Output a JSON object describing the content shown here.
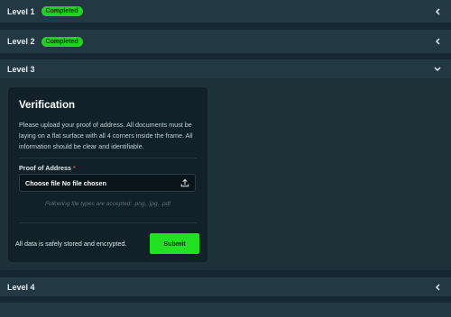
{
  "levels": [
    {
      "label": "Level 1",
      "badge": "Completed",
      "chevron": "chevron-left-icon"
    },
    {
      "label": "Level 2",
      "badge": "Completed",
      "chevron": "chevron-left-icon"
    },
    {
      "label": "Level 3",
      "badge": "",
      "chevron": "chevron-down-icon"
    },
    {
      "label": "Level 4",
      "badge": "",
      "chevron": "chevron-left-icon"
    }
  ],
  "verification": {
    "title": "Verification",
    "description": "Please upload your proof of address. All documents must be laying on a flat surface with all 4 corners inside the frame. All information should be clear and identifiable.",
    "field_label": "Proof of Address",
    "required_mark": "*",
    "file_input_text": "Choose file No file chosen",
    "upload_icon": "upload-icon",
    "hint": "Following file types are accepted: .png, .jpg, .pdf",
    "footer_text": "All data is safely stored and encrypted.",
    "submit_label": "Submit"
  },
  "colors": {
    "background": "#1b2e37",
    "bar": "#223944",
    "card": "#122129",
    "accent": "#22e022"
  }
}
